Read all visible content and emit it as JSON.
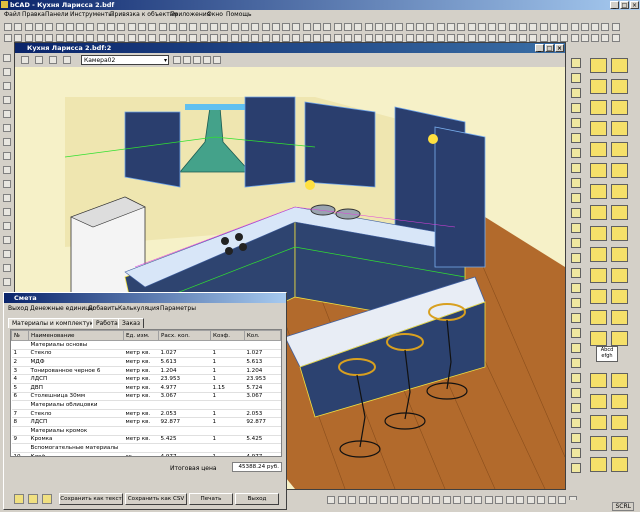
{
  "app": {
    "title": "bCAD - Кухня Ларисса 2.bdf"
  },
  "menu": [
    "Файл",
    "Правка",
    "Панели",
    "Инструменты",
    "Привязка к объектам",
    "Приложения",
    "Окно",
    "Помощь"
  ],
  "document": {
    "title": "Кухня Ларисса 2.bdf:2",
    "camera": "Камера02"
  },
  "dialog": {
    "title": "Смета",
    "menu": [
      "Выход",
      "Денежные единицы",
      "Добавить",
      "Калькуляция",
      "Параметры"
    ],
    "tabs": [
      "Материалы и комплектующие",
      "Работа",
      "Заказ"
    ],
    "columns": [
      "№",
      "Наименование",
      "Ед. изм.",
      "Расх. кол.",
      "Коэф.",
      "Кол."
    ],
    "rows": [
      {
        "n": "",
        "name": "Материалы основы",
        "unit": "",
        "qty": "",
        "coef": "",
        "total": ""
      },
      {
        "n": "1",
        "name": "Стекло",
        "unit": "метр кв.",
        "qty": "1.027",
        "coef": "1",
        "total": "1.027"
      },
      {
        "n": "2",
        "name": "МДФ",
        "unit": "метр кв.",
        "qty": "5.613",
        "coef": "1",
        "total": "5.613"
      },
      {
        "n": "3",
        "name": "Тонированное черное 6",
        "unit": "метр кв.",
        "qty": "1.204",
        "coef": "1",
        "total": "1.204"
      },
      {
        "n": "4",
        "name": "ЛДСП",
        "unit": "метр кв.",
        "qty": "23.953",
        "coef": "1",
        "total": "23.953"
      },
      {
        "n": "5",
        "name": "ДВП",
        "unit": "метр кв.",
        "qty": "4.977",
        "coef": "1.15",
        "total": "5.724"
      },
      {
        "n": "6",
        "name": "Столешница 30мм",
        "unit": "метр кв.",
        "qty": "3.067",
        "coef": "1",
        "total": "3.067"
      },
      {
        "n": "",
        "name": "Материалы облицовки",
        "unit": "",
        "qty": "",
        "coef": "",
        "total": ""
      },
      {
        "n": "7",
        "name": "Стекло",
        "unit": "метр кв.",
        "qty": "2.053",
        "coef": "1",
        "total": "2.053"
      },
      {
        "n": "8",
        "name": "ЛДСП",
        "unit": "метр кв.",
        "qty": "92.877",
        "coef": "1",
        "total": "92.877"
      },
      {
        "n": "",
        "name": "Материалы кромок",
        "unit": "",
        "qty": "",
        "coef": "",
        "total": ""
      },
      {
        "n": "9",
        "name": "Кромка",
        "unit": "метр кв.",
        "qty": "5.425",
        "coef": "1",
        "total": "5.425"
      },
      {
        "n": "",
        "name": "Вспомогательные материалы",
        "unit": "",
        "qty": "",
        "coef": "",
        "total": ""
      },
      {
        "n": "10",
        "name": "Клей",
        "unit": "кг.",
        "qty": "4.977",
        "coef": "1",
        "total": "4.977"
      }
    ],
    "total_label": "Итоговая цена",
    "total_value": "45388.24 руб.",
    "buttons": [
      "Сохранить как текст",
      "Сохранить как CSV",
      "Печать",
      "Выход"
    ]
  },
  "status": {
    "scrl": "SCRL"
  }
}
